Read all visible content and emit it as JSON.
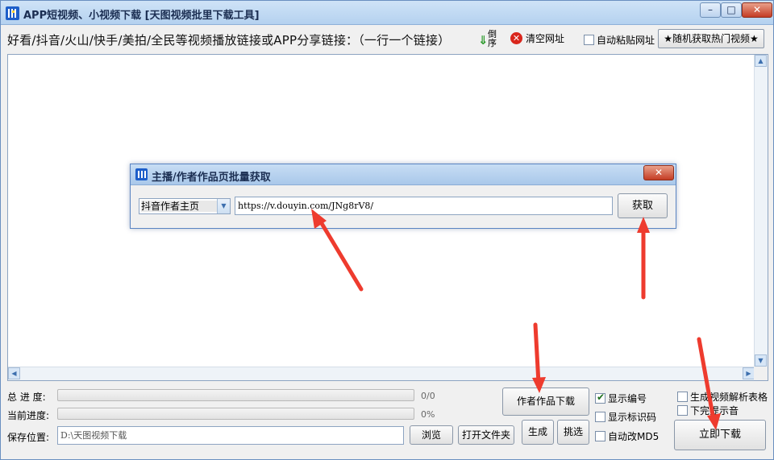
{
  "window": {
    "title": "APP短视频、小视频下载 [天图视频批里下载工具]",
    "min_glyph": "–",
    "max_glyph": "□",
    "close_glyph": "✕"
  },
  "header": {
    "hint": "好看/抖音/火山/快手/美拍/全民等视频播放链接或APP分享链接：（一行一个链接）",
    "sort_arrow": "⇓",
    "sort_label": "倒序",
    "clear_icon": "✕",
    "clear_label": "清空网址",
    "auto_paste_label": "自动粘贴网址",
    "random_button": "★随机获取热门视频★"
  },
  "scrollbar": {
    "up": "▲",
    "down": "▼",
    "left": "◀",
    "right": "▶"
  },
  "dialog": {
    "title": "主播/作者作品页批量获取",
    "close_glyph": "✕",
    "select_value": "抖音作者主页",
    "select_arrow": "▼",
    "url_value": "https://v.douyin.com/JNg8rV8/",
    "fetch_button": "获取"
  },
  "bottom": {
    "total_label": "总 进 度:",
    "total_value": "0/0",
    "total_progress": 0,
    "current_label": "当前进度:",
    "current_value": "0%",
    "current_progress": 0,
    "save_label": "保存位置:",
    "save_path": "D:\\天图视频下载",
    "browse_button": "浏览",
    "open_folder_button": "打开文件夹",
    "author_download_button": "作者作品下载",
    "generate_button": "生成",
    "pick_button": "挑选",
    "show_number_label": "显示编号",
    "show_number_checked": true,
    "show_id_label": "显示标识码",
    "show_id_checked": false,
    "auto_md5_label": "自动改MD5",
    "auto_md5_checked": false,
    "gen_table_label": "生成视频解析表格",
    "gen_table_checked": false,
    "done_sound_label": "下完提示音",
    "done_sound_checked": false,
    "download_now_button": "立即下载"
  },
  "colors": {
    "accent": "#1d5ec9",
    "arrow": "#ee3b2e",
    "close_red": "#c43c24"
  }
}
